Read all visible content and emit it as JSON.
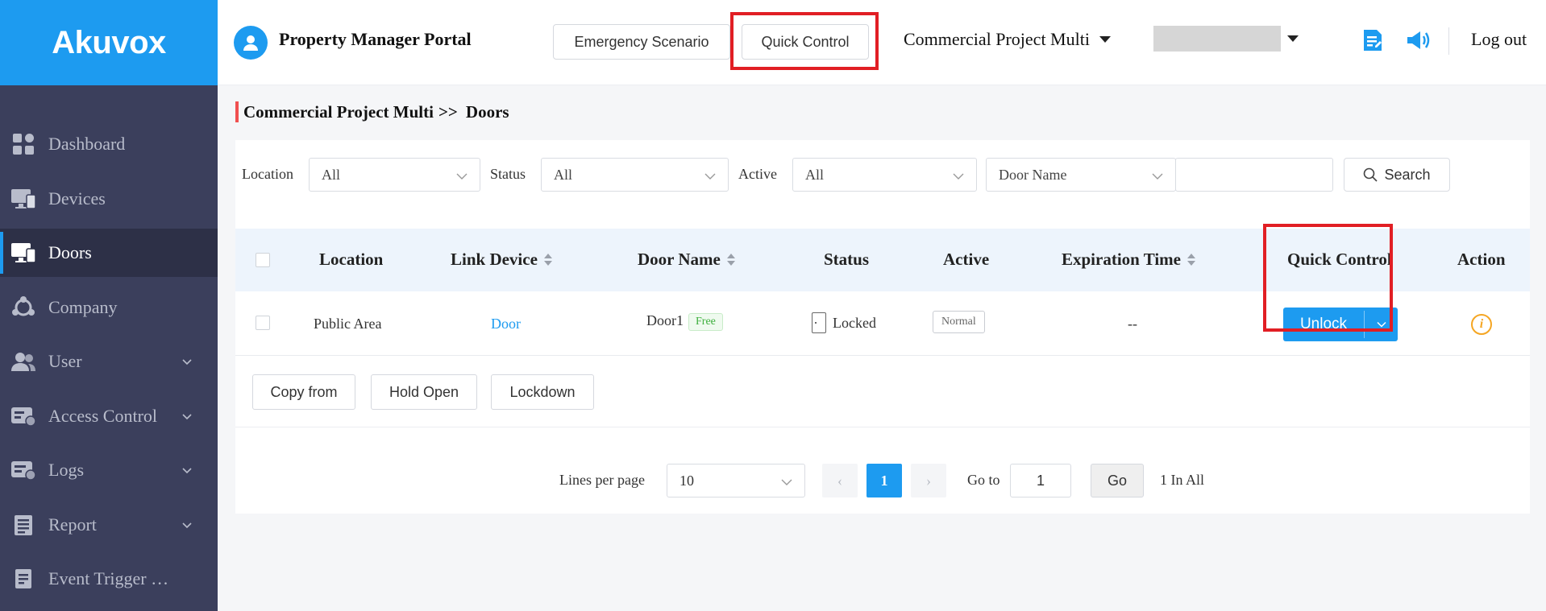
{
  "brand": {
    "logo": "Akuvox",
    "color": "#1d9bf0"
  },
  "header": {
    "portal_title": "Property Manager Portal",
    "emergency_button": "Emergency Scenario",
    "quick_control_button": "Quick Control",
    "project": "Commercial Project Multi",
    "logout": "Log out",
    "icons": [
      "document-icon",
      "announcement-icon"
    ]
  },
  "sidebar": {
    "items": [
      {
        "label": "Dashboard",
        "icon": "dashboard-icon",
        "expandable": false,
        "active": false
      },
      {
        "label": "Devices",
        "icon": "devices-icon",
        "expandable": false,
        "active": false
      },
      {
        "label": "Doors",
        "icon": "doors-icon",
        "expandable": false,
        "active": true
      },
      {
        "label": "Company",
        "icon": "company-icon",
        "expandable": false,
        "active": false
      },
      {
        "label": "User",
        "icon": "user-icon",
        "expandable": true,
        "active": false
      },
      {
        "label": "Access Control",
        "icon": "access-control-icon",
        "expandable": true,
        "active": false
      },
      {
        "label": "Logs",
        "icon": "logs-icon",
        "expandable": true,
        "active": false
      },
      {
        "label": "Report",
        "icon": "report-icon",
        "expandable": true,
        "active": false
      },
      {
        "label": "Event Trigger …",
        "icon": "event-trigger-icon",
        "expandable": false,
        "active": false
      }
    ]
  },
  "breadcrumb": {
    "parent": "Commercial Project Multi",
    "separator": ">>",
    "current": "Doors"
  },
  "filters": {
    "location": {
      "label": "Location",
      "value": "All"
    },
    "status": {
      "label": "Status",
      "value": "All"
    },
    "active": {
      "label": "Active",
      "value": "All"
    },
    "door_name": {
      "value": "Door Name",
      "input": ""
    },
    "search_button": "Search"
  },
  "table": {
    "columns": [
      "Location",
      "Link Device",
      "Door Name",
      "Status",
      "Active",
      "Expiration Time",
      "Quick Control",
      "Action"
    ],
    "rows": [
      {
        "location": "Public Area",
        "link_device": "Door",
        "door_name": "Door1",
        "door_tag": "Free",
        "status": "Locked",
        "active": "Normal",
        "expiration": "--",
        "quick_control": "Unlock"
      }
    ]
  },
  "actions": {
    "copy_from": "Copy from",
    "hold_open": "Hold Open",
    "lockdown": "Lockdown"
  },
  "pagination": {
    "lines_label": "Lines per page",
    "lines_value": "10",
    "prev": "‹",
    "current_page": "1",
    "next": "›",
    "goto_label": "Go to",
    "goto_value": "1",
    "go_button": "Go",
    "total": "1 In All"
  },
  "highlight_color": "#e11e24"
}
